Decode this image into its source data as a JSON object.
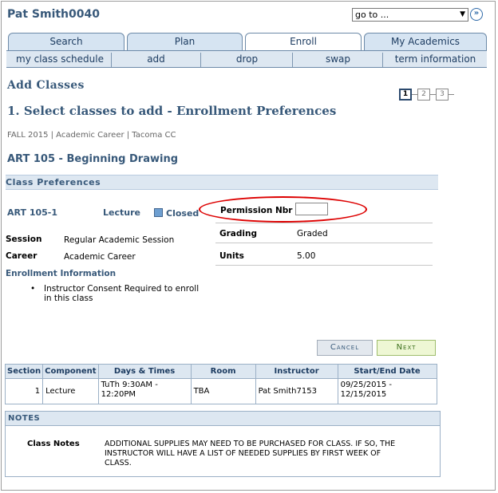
{
  "header": {
    "user_name": "Pat Smith0040",
    "goto_label": "go to ...",
    "go_icon": "double-chevron-right-icon"
  },
  "tabs": [
    {
      "label": "Search"
    },
    {
      "label": "Plan"
    },
    {
      "label": "Enroll",
      "active": true
    },
    {
      "label": "My Academics"
    }
  ],
  "subtabs": [
    {
      "label": "my class schedule"
    },
    {
      "label": "add",
      "active": true
    },
    {
      "label": "drop"
    },
    {
      "label": "swap"
    },
    {
      "label": "term information"
    }
  ],
  "page": {
    "title": "Add Classes",
    "steps": [
      "1",
      "2",
      "3"
    ],
    "current_step": 1,
    "heading": "1.  Select classes to add - Enrollment Preferences",
    "breadcrumb": "FALL 2015 | Academic Career | Tacoma CC",
    "course_title": "ART  105 - Beginning Drawing"
  },
  "class_preferences": {
    "section_title": "Class Preferences",
    "class_id": "ART  105-1",
    "component": "Lecture",
    "status": "Closed",
    "permission_label": "Permission Nbr",
    "permission_value": "",
    "grading_label": "Grading",
    "grading_value": "Graded",
    "units_label": "Units",
    "units_value": "5.00",
    "session_label": "Session",
    "session_value": "Regular Academic Session",
    "career_label": "Career",
    "career_value": "Academic Career",
    "enroll_info_label": "Enrollment Information",
    "enroll_info_item": "Instructor Consent Required to enroll in this class"
  },
  "buttons": {
    "cancel": "Cancel",
    "next": "Next"
  },
  "schedule": {
    "headers": [
      "Section",
      "Component",
      "Days & Times",
      "Room",
      "Instructor",
      "Start/End Date"
    ],
    "rows": [
      [
        "1",
        "Lecture",
        "TuTh 9:30AM - 12:20PM",
        "TBA",
        "Pat Smith7153",
        "09/25/2015 - 12/15/2015"
      ]
    ]
  },
  "notes": {
    "header": "NOTES",
    "label": "Class Notes",
    "text": "ADDITIONAL SUPPLIES MAY NEED TO BE PURCHASED FOR CLASS. IF SO, THE INSTRUCTOR WILL HAVE A LIST OF NEEDED SUPPLIES BY FIRST WEEK OF CLASS."
  },
  "colors": {
    "title_blue": "#38597a",
    "header_bg": "#dde7f1",
    "highlight_red": "#dd0000"
  }
}
